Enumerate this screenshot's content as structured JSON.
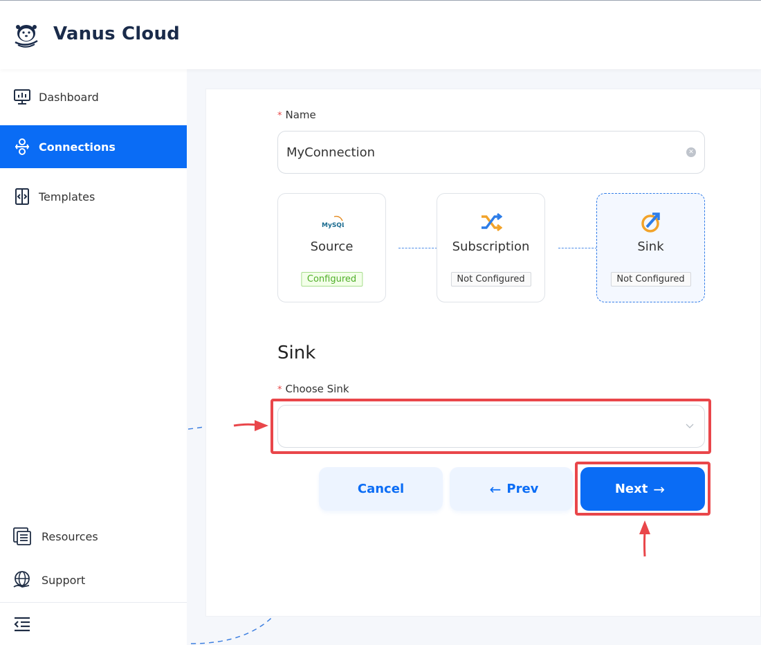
{
  "header": {
    "brand": "Vanus Cloud",
    "logo": "otter-logo"
  },
  "sidebar": {
    "items": [
      {
        "label": "Dashboard",
        "icon": "monitor-chart-icon",
        "active": false
      },
      {
        "label": "Connections",
        "icon": "connections-icon",
        "active": true
      },
      {
        "label": "Templates",
        "icon": "code-file-icon",
        "active": false
      }
    ],
    "bottom_items": [
      {
        "label": "Resources",
        "icon": "resources-icon"
      },
      {
        "label": "Support",
        "icon": "globe-hand-icon"
      }
    ],
    "collapse_icon": "menu-collapse-icon"
  },
  "form": {
    "name_label": "Name",
    "name_value": "MyConnection",
    "steps": [
      {
        "title": "Source",
        "badge": "Configured",
        "status": "configured",
        "icon": "mysql-icon",
        "icon_text": "MySQL"
      },
      {
        "title": "Subscription",
        "badge": "Not Configured",
        "status": "not-configured",
        "icon": "shuffle-icon"
      },
      {
        "title": "Sink",
        "badge": "Not Configured",
        "status": "not-configured",
        "icon": "sink-icon"
      }
    ],
    "section_title": "Sink",
    "choose_label": "Choose Sink",
    "choose_value": ""
  },
  "buttons": {
    "cancel": "Cancel",
    "prev": "Prev",
    "next": "Next"
  },
  "colors": {
    "primary": "#0a6cf5",
    "annotation": "#e9464a",
    "configured": "#4fae28"
  }
}
